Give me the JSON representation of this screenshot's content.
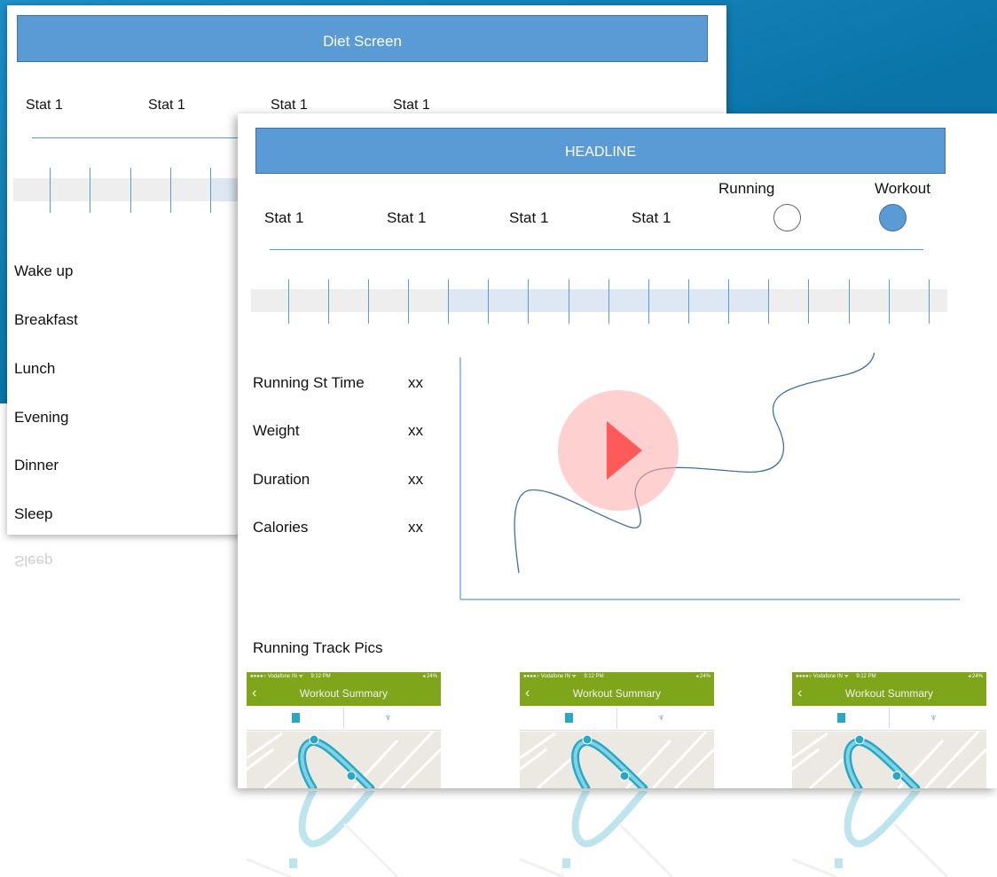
{
  "back_screen": {
    "title": "Diet Screen",
    "stats": [
      "Stat 1",
      "Stat 1",
      "Stat 1",
      "Stat 1"
    ],
    "meals": [
      "Wake up",
      "Breakfast",
      "Lunch",
      "Evening",
      "Dinner",
      "Sleep"
    ]
  },
  "front_screen": {
    "headline": "HEADLINE",
    "stats": [
      "Stat 1",
      "Stat 1",
      "Stat 1",
      "Stat 1"
    ],
    "modes": [
      {
        "label": "Running",
        "selected": false
      },
      {
        "label": "Workout",
        "selected": true
      }
    ],
    "metrics": [
      {
        "label": "Running St Time",
        "value": "xx"
      },
      {
        "label": "Weight",
        "value": "xx"
      },
      {
        "label": "Duration",
        "value": "xx"
      },
      {
        "label": "Calories",
        "value": "xx"
      }
    ],
    "pics_title": "Running Track Pics",
    "thumbnails": [
      {
        "carrier": "●●●●○ Vodafone IN  ᯤ",
        "time": "9:12 PM",
        "battery": "◂ 24%",
        "title": "Workout Summary"
      },
      {
        "carrier": "●●●●○ Vodafone IN  ᯤ",
        "time": "9:12 PM",
        "battery": "◂ 24%",
        "title": "Workout Summary"
      },
      {
        "carrier": "●●●●○ Vodafone IN  ᯤ",
        "time": "9:12 PM",
        "battery": "◂ 24%",
        "title": "Workout Summary"
      }
    ]
  },
  "colors": {
    "accent": "#5b9bd5",
    "backdrop": "#0a74a8",
    "play_overlay": "#ff5a5a",
    "thumb_bar": "#7fa51a",
    "route": "#2aa7c4"
  },
  "icons": {
    "play": "play-icon",
    "back": "chevron-left-icon",
    "list": "list-icon",
    "trophy": "trophy-icon"
  }
}
